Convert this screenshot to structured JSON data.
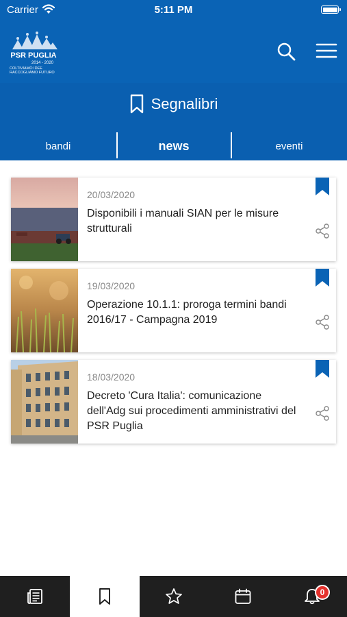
{
  "status_bar": {
    "carrier": "Carrier",
    "time": "5:11 PM",
    "wifi_icon": "wifi-icon",
    "battery_icon": "battery-icon"
  },
  "navbar": {
    "logo_title": "PSR PUGLIA",
    "logo_years": "2014 - 2020",
    "logo_tagline_1": "COLTIVIAMO IDEE",
    "logo_tagline_2": "RACCOGLIAMO FUTURO",
    "search_icon": "search-icon",
    "menu_icon": "menu-icon"
  },
  "page": {
    "title": "Segnalibri",
    "title_icon": "bookmark-outline-icon"
  },
  "tabs": [
    {
      "label": "bandi",
      "active": false
    },
    {
      "label": "news",
      "active": true
    },
    {
      "label": "eventi",
      "active": false
    }
  ],
  "news": [
    {
      "date": "20/03/2020",
      "title": "Disponibili i manuali SIAN per le misure strutturali",
      "bookmarked": true
    },
    {
      "date": "19/03/2020",
      "title": "Operazione 10.1.1: proroga termini bandi 2016/17 - Campagna 2019",
      "bookmarked": true
    },
    {
      "date": "18/03/2020",
      "title": "Decreto 'Cura Italia': comunicazione dell'Adg sui procedimenti amministrativi del PSR Puglia",
      "bookmarked": true
    }
  ],
  "tabbar": {
    "items": [
      {
        "icon": "news-list-icon",
        "active": false
      },
      {
        "icon": "bookmark-icon",
        "active": true
      },
      {
        "icon": "star-icon",
        "active": false
      },
      {
        "icon": "calendar-icon",
        "active": false
      },
      {
        "icon": "bell-icon",
        "active": false
      }
    ],
    "notifications_count": "0"
  },
  "colors": {
    "primary_blue": "#0a63b5",
    "tabbar_dark": "#1f1f1f",
    "badge_red": "#e5322d"
  }
}
